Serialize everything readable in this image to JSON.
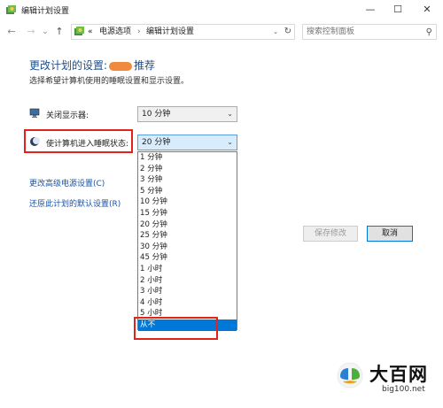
{
  "window": {
    "title": "编辑计划设置",
    "minimize_glyph": "—",
    "maximize_glyph": "☐",
    "close_glyph": "✕"
  },
  "nav": {
    "back_glyph": "←",
    "forward_glyph": "→",
    "recent_glyph": "⌄",
    "up_glyph": "↑",
    "overflow_glyph": "«",
    "breadcrumb": [
      "电源选项",
      "编辑计划设置"
    ],
    "separator": "›",
    "dropdown_glyph": "⌄",
    "refresh_glyph": "↻",
    "search_placeholder": "搜索控制面板",
    "search_glyph": "⚲"
  },
  "main": {
    "heading_prefix": "更改计划的设置:",
    "heading_suffix": "推荐",
    "subtitle": "选择希望计算机使用的睡眠设置和显示设置。",
    "display_off": {
      "label": "关闭显示器:",
      "value": "10 分钟"
    },
    "sleep": {
      "label": "使计算机进入睡眠状态:",
      "value": "20 分钟"
    },
    "sleep_options": [
      "1 分钟",
      "2 分钟",
      "3 分钟",
      "5 分钟",
      "10 分钟",
      "15 分钟",
      "20 分钟",
      "25 分钟",
      "30 分钟",
      "45 分钟",
      "1 小时",
      "2 小时",
      "3 小时",
      "4 小时",
      "5 小时",
      "从不"
    ],
    "selected_option": "从不",
    "links": [
      "更改高级电源设置(C)",
      "还原此计划的默认设置(R)"
    ],
    "save_button": "保存修改",
    "cancel_button": "取消"
  },
  "brand": {
    "name": "大百网",
    "url": "big100.net"
  },
  "colors": {
    "accent": "#0078d7",
    "highlight_box": "#e2231a",
    "heading": "#1e4e8c",
    "link": "#1a54a8"
  }
}
